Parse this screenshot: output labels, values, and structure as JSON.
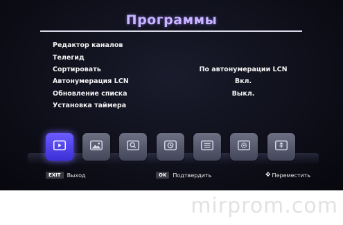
{
  "title": "Программы",
  "menu": [
    {
      "label": "Редактор каналов",
      "value": ""
    },
    {
      "label": "Телегид",
      "value": ""
    },
    {
      "label": "Сортировать",
      "value": "По автонумерации LCN"
    },
    {
      "label": "Автонумерация LCN",
      "value": "Вкл."
    },
    {
      "label": "Обновление списка",
      "value": "Выкл."
    },
    {
      "label": "Установка таймера",
      "value": ""
    }
  ],
  "dock": [
    {
      "icon": "tv-icon",
      "active": true
    },
    {
      "icon": "picture-icon",
      "active": false
    },
    {
      "icon": "search-icon",
      "active": false
    },
    {
      "icon": "clock-icon",
      "active": false
    },
    {
      "icon": "list-icon",
      "active": false
    },
    {
      "icon": "gear-icon",
      "active": false
    },
    {
      "icon": "usb-icon",
      "active": false
    }
  ],
  "footer": {
    "exit_key": "EXIT",
    "exit_label": "Выход",
    "ok_key": "OK",
    "ok_label": "Подтвердить",
    "move_icon": "move-arrows-icon",
    "move_label": "Переместить"
  },
  "watermark": "mirprom.com",
  "colors": {
    "title": "#c9b4ff",
    "active_tile": "#5044f0",
    "tile": "#5a5c70",
    "background": "#0c0d16"
  }
}
